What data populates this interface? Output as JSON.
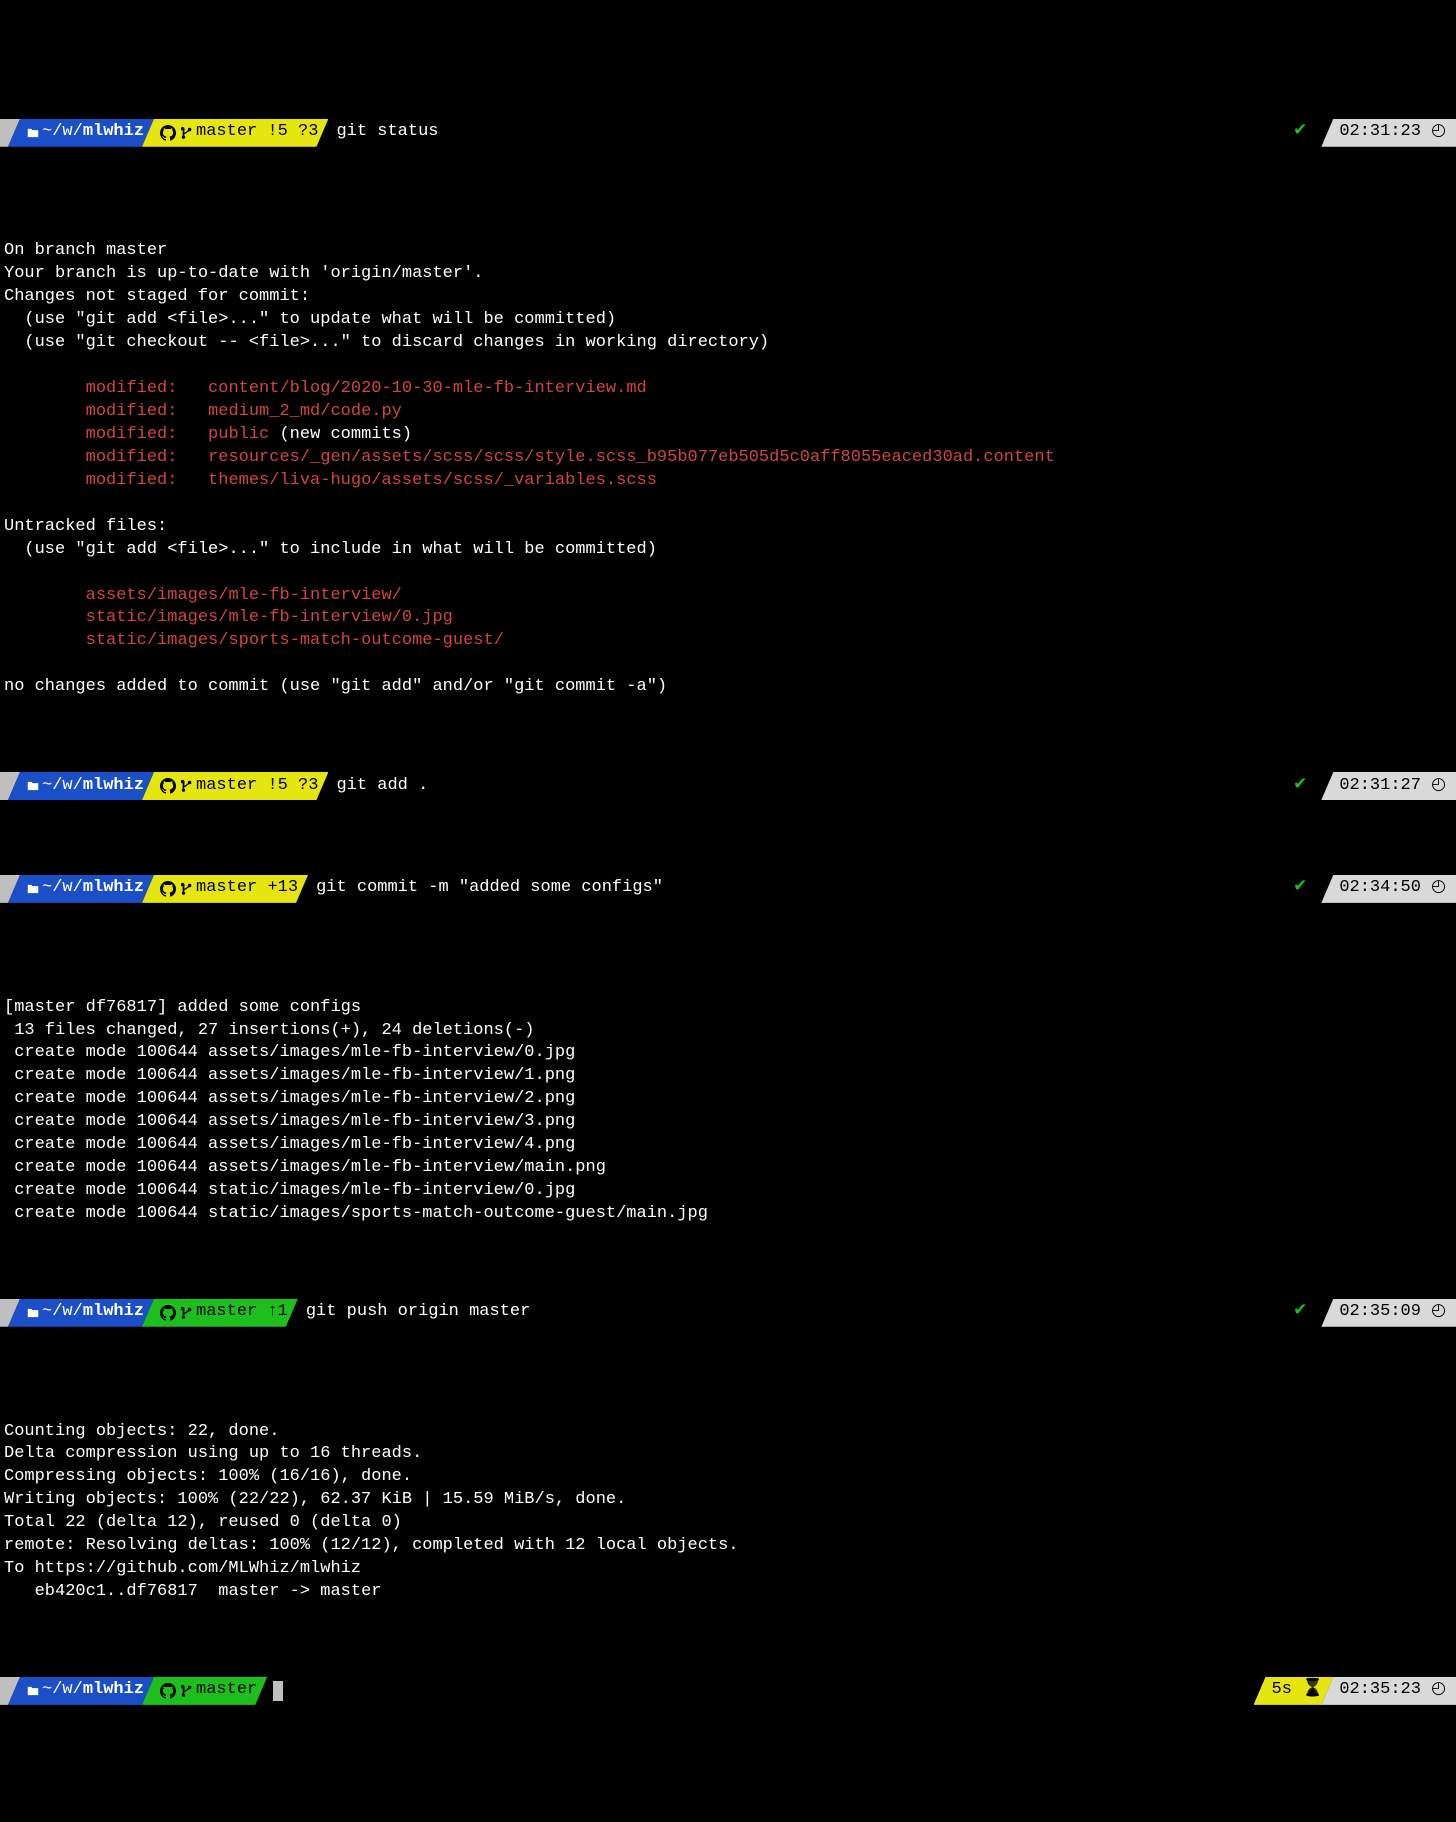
{
  "prompts": [
    {
      "path_prefix": "~/w/",
      "path_bold": "mlwhiz",
      "branch": "master !5 ?3",
      "branch_color": "yellow",
      "command": "git status",
      "check": true,
      "time": "02:31:23",
      "duration": null
    },
    {
      "path_prefix": "~/w/",
      "path_bold": "mlwhiz",
      "branch": "master !5 ?3",
      "branch_color": "yellow",
      "command": "git add .",
      "check": true,
      "time": "02:31:27",
      "duration": null
    },
    {
      "path_prefix": "~/w/",
      "path_bold": "mlwhiz",
      "branch": "master +13",
      "branch_color": "yellow",
      "command": "git commit -m \"added some configs\"",
      "check": true,
      "time": "02:34:50",
      "duration": null
    },
    {
      "path_prefix": "~/w/",
      "path_bold": "mlwhiz",
      "branch": "master ↑1",
      "branch_color": "green",
      "command": "git push origin master",
      "check": true,
      "time": "02:35:09",
      "duration": null
    },
    {
      "path_prefix": "~/w/",
      "path_bold": "mlwhiz",
      "branch": "master",
      "branch_color": "green",
      "command": "",
      "check": false,
      "time": "02:35:23",
      "duration": "5s",
      "cursor": true
    }
  ],
  "out1": {
    "l1": "On branch master",
    "l2": "Your branch is up-to-date with 'origin/master'.",
    "l3": "Changes not staged for commit:",
    "l4": "  (use \"git add <file>...\" to update what will be committed)",
    "l5": "  (use \"git checkout -- <file>...\" to discard changes in working directory)",
    "m1": "        modified:   content/blog/2020-10-30-mle-fb-interview.md",
    "m2": "        modified:   medium_2_md/code.py",
    "m3_a": "        modified:   public",
    "m3_b": " (new commits)",
    "m4": "        modified:   resources/_gen/assets/scss/scss/style.scss_b95b077eb505d5c0aff8055eaced30ad.content",
    "m5": "        modified:   themes/liva-hugo/assets/scss/_variables.scss",
    "u_hdr": "Untracked files:",
    "u_hint": "  (use \"git add <file>...\" to include in what will be committed)",
    "u1": "        assets/images/mle-fb-interview/",
    "u2": "        static/images/mle-fb-interview/0.jpg",
    "u3": "        static/images/sports-match-outcome-guest/",
    "foot": "no changes added to commit (use \"git add\" and/or \"git commit -a\")"
  },
  "out3": {
    "l1": "[master df76817] added some configs",
    "l2": " 13 files changed, 27 insertions(+), 24 deletions(-)",
    "l3": " create mode 100644 assets/images/mle-fb-interview/0.jpg",
    "l4": " create mode 100644 assets/images/mle-fb-interview/1.png",
    "l5": " create mode 100644 assets/images/mle-fb-interview/2.png",
    "l6": " create mode 100644 assets/images/mle-fb-interview/3.png",
    "l7": " create mode 100644 assets/images/mle-fb-interview/4.png",
    "l8": " create mode 100644 assets/images/mle-fb-interview/main.png",
    "l9": " create mode 100644 static/images/mle-fb-interview/0.jpg",
    "l10": " create mode 100644 static/images/sports-match-outcome-guest/main.jpg"
  },
  "out4": {
    "l1": "Counting objects: 22, done.",
    "l2": "Delta compression using up to 16 threads.",
    "l3": "Compressing objects: 100% (16/16), done.",
    "l4": "Writing objects: 100% (22/22), 62.37 KiB | 15.59 MiB/s, done.",
    "l5": "Total 22 (delta 12), reused 0 (delta 0)",
    "l6": "remote: Resolving deltas: 100% (12/12), completed with 12 local objects.",
    "l7": "To https://github.com/MLWhiz/mlwhiz",
    "l8": "   eb420c1..df76817  master -> master"
  }
}
